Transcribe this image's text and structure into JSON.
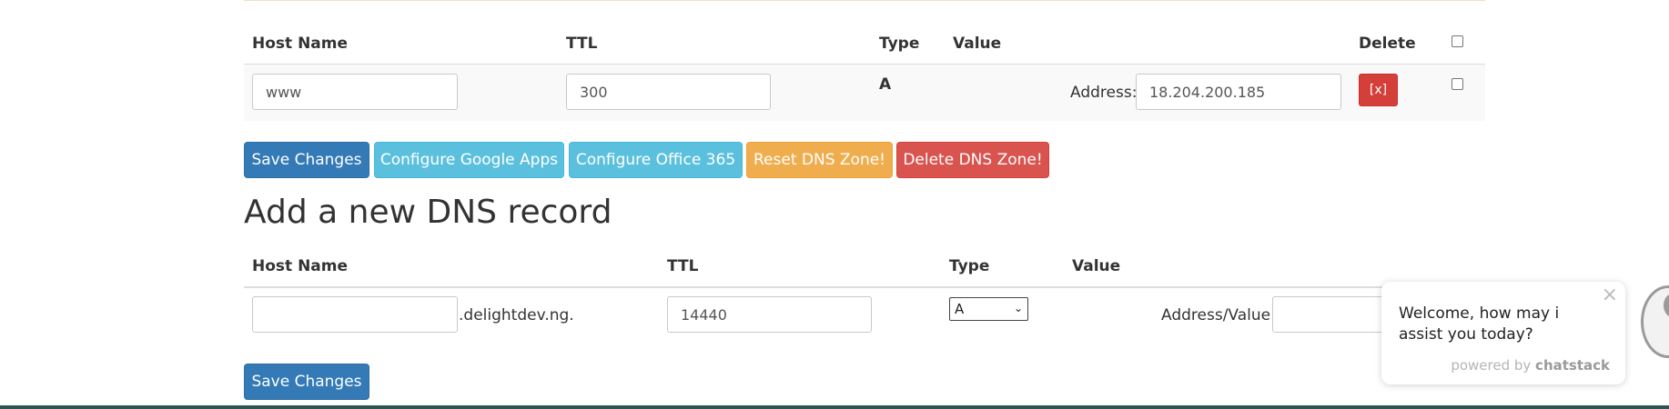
{
  "dns_table": {
    "headers": {
      "host_name": "Host Name",
      "ttl": "TTL",
      "type": "Type",
      "value": "Value",
      "delete": "Delete"
    },
    "record": {
      "host_value": "www",
      "ttl_value": "300",
      "type": "A",
      "address_label": "Address:",
      "address_value": "18.204.200.185",
      "delete_label": "[x]"
    }
  },
  "actions": {
    "save_changes": "Save Changes",
    "configure_google": "Configure Google Apps",
    "configure_office": "Configure Office 365",
    "reset_zone": "Reset DNS Zone!",
    "delete_zone": "Delete DNS Zone!"
  },
  "add_record": {
    "title": "Add a new DNS record",
    "headers": {
      "host_name": "Host Name",
      "ttl": "TTL",
      "type": "Type",
      "value": "Value"
    },
    "host_value": "",
    "domain_suffix": ".delightdev.ng.",
    "ttl_value": "14440",
    "type_selected": "A",
    "address_label": "Address/Value:",
    "save_changes": "Save Changes"
  },
  "chat_widget": {
    "message": "Welcome, how may i assist you today?",
    "powered_prefix": "powered by",
    "powered_brand": "chatstack",
    "close_icon": "close-icon"
  },
  "colors": {
    "primary": "#337ab7",
    "info": "#5bc0de",
    "warning": "#f0ad4e",
    "danger": "#d9534f"
  }
}
